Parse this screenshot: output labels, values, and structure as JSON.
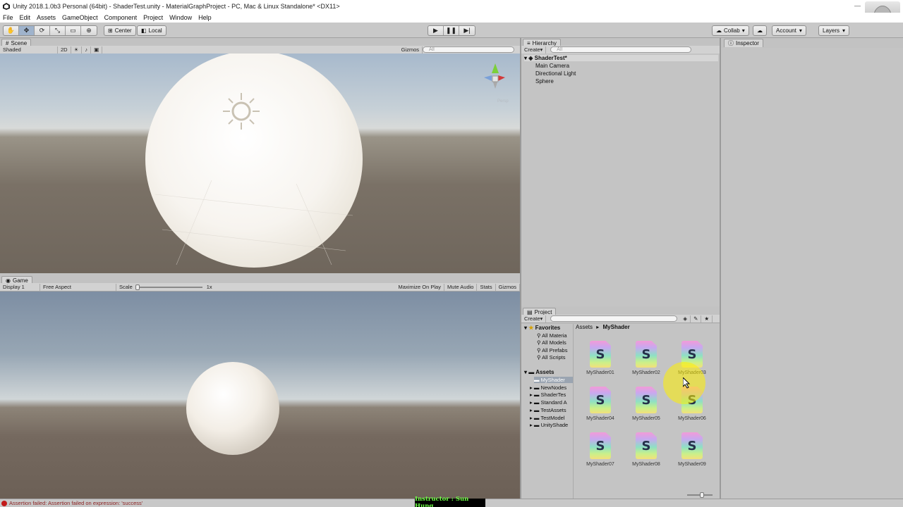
{
  "window": {
    "title": "Unity 2018.1.0b3 Personal (64bit) - ShaderTest.unity - MaterialGraphProject - PC, Mac & Linux Standalone* <DX11>"
  },
  "menu": [
    "File",
    "Edit",
    "Assets",
    "GameObject",
    "Component",
    "Project",
    "Window",
    "Help"
  ],
  "toolbar": {
    "center_label": "Center",
    "local_label": "Local",
    "collab_label": "Collab",
    "account_label": "Account",
    "layers_label": "Layers"
  },
  "scene": {
    "tab_label": "Scene",
    "shading_mode": "Shaded",
    "mode_2d": "2D",
    "gizmos_label": "Gizmos",
    "search_placeholder": "All",
    "persp_label": "Persp"
  },
  "game": {
    "tab_label": "Game",
    "display": "Display 1",
    "aspect": "Free Aspect",
    "scale_label": "Scale",
    "scale_value": "1x",
    "maximize_label": "Maximize On Play",
    "mute_label": "Mute Audio",
    "stats_label": "Stats",
    "gizmos_label": "Gizmos"
  },
  "hierarchy": {
    "tab_label": "Hierarchy",
    "create_label": "Create",
    "search_placeholder": "All",
    "scene_name": "ShaderTest*",
    "items": [
      "Main Camera",
      "Directional Light",
      "Sphere"
    ]
  },
  "inspector": {
    "tab_label": "Inspector"
  },
  "project": {
    "tab_label": "Project",
    "create_label": "Create",
    "favorites_label": "Favorites",
    "favorites": [
      "All Materia",
      "All Models",
      "All Prefabs",
      "All Scripts"
    ],
    "assets_label": "Assets",
    "folders": [
      "MyShader",
      "NewNodes",
      "ShaderTes",
      "Standard A",
      "TestAssets",
      "TestModel",
      "UnityShade"
    ],
    "breadcrumb": [
      "Assets",
      "MyShader"
    ],
    "files": [
      "MyShader01",
      "MyShader02",
      "MyShader03",
      "MyShader04",
      "MyShader05",
      "MyShader06",
      "MyShader07",
      "MyShader08",
      "MyShader09"
    ]
  },
  "status": {
    "message": "Assertion failed: Assertion failed on expression: 'success'",
    "instructor": "Instructor : Sun Hung"
  },
  "colors": {
    "panel_bg": "#c4c4c4",
    "selection": "#9aa4b1",
    "error": "#c21b1b",
    "instructor_text": "#6dff45"
  }
}
